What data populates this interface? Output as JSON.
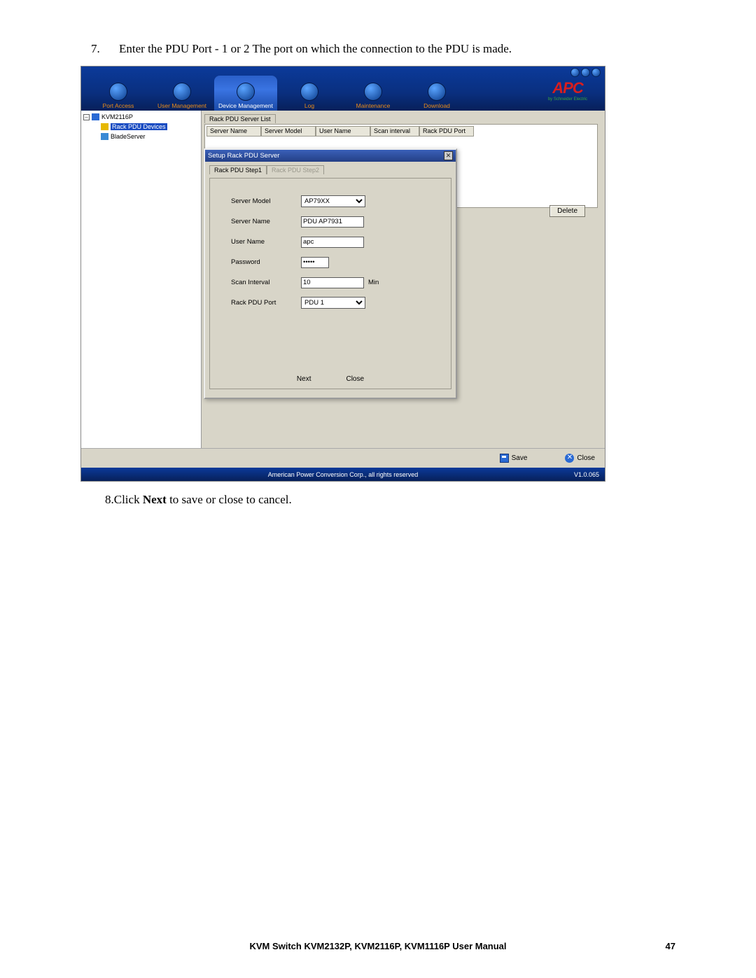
{
  "doc": {
    "step7_num": "7.",
    "step7_text": "Enter the PDU Port - 1 or 2 The port on which the connection to the PDU is made.",
    "step8_num": "8.",
    "step8_pre": "Click ",
    "step8_bold": "Next",
    "step8_post": " to save or close to cancel.",
    "footer": "KVM Switch KVM2132P, KVM2116P, KVM1116P User Manual",
    "pagenum": "47"
  },
  "logo": {
    "brand": "APC",
    "sub": "by Schneider Electric"
  },
  "nav": {
    "items": [
      "Port Access",
      "User Management",
      "Device Management",
      "Log",
      "Maintenance",
      "Download"
    ],
    "active_index": 2
  },
  "tree": {
    "root": "KVM2116P",
    "child1": "Rack PDU Devices",
    "child2": "BladeServer"
  },
  "list": {
    "tab": "Rack PDU Server List",
    "cols": [
      "Server Name",
      "Server Model",
      "User Name",
      "Scan interval",
      "Rack PDU Port"
    ],
    "delete": "Delete"
  },
  "dialog": {
    "title": "Setup Rack PDU Server",
    "tab1": "Rack PDU Step1",
    "tab2": "Rack PDU Step2",
    "fields": {
      "server_model_label": "Server Model",
      "server_model_value": "AP79XX",
      "server_name_label": "Server Name",
      "server_name_value": "PDU AP7931",
      "user_name_label": "User Name",
      "user_name_value": "apc",
      "password_label": "Password",
      "password_value": "xxxxx",
      "scan_interval_label": "Scan Interval",
      "scan_interval_value": "10",
      "scan_unit": "Min",
      "rack_pdu_port_label": "Rack PDU Port",
      "rack_pdu_port_value": "PDU 1"
    },
    "next": "Next",
    "close": "Close"
  },
  "bottom": {
    "save": "Save",
    "close": "Close"
  },
  "status": {
    "copyright": "American Power Conversion Corp., all rights reserved",
    "version": "V1.0.065"
  }
}
